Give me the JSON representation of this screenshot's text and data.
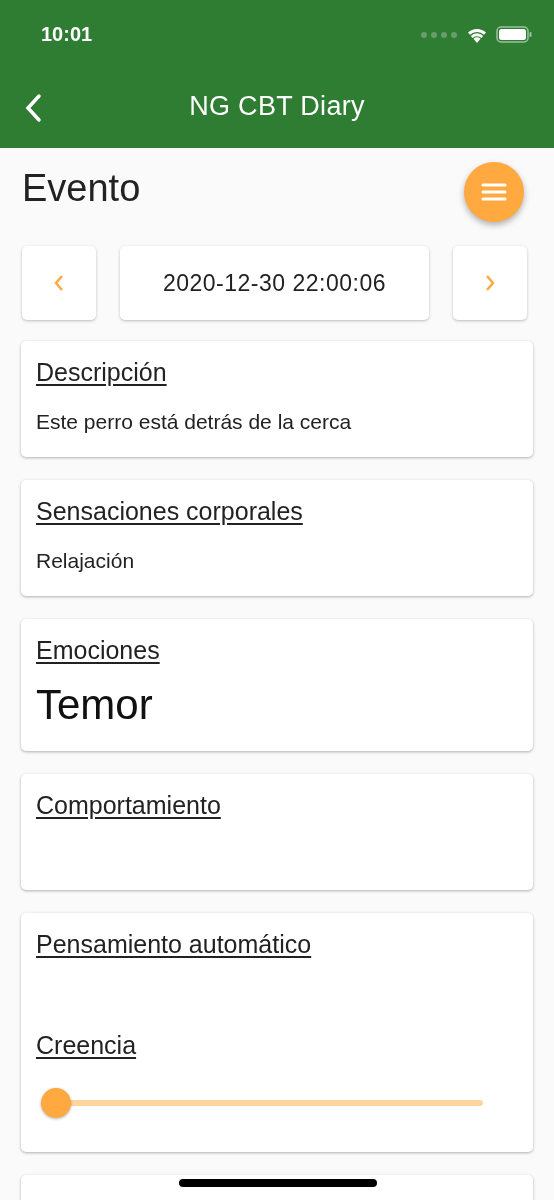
{
  "status_bar": {
    "time": "10:01"
  },
  "nav_bar": {
    "title": "NG CBT Diary"
  },
  "screen_title": "Evento",
  "date_nav": {
    "value": "2020-12-30 22:00:06"
  },
  "cards": [
    {
      "kind": "text",
      "heading": "Descripción",
      "value": "Este perro está detrás de la cerca"
    },
    {
      "kind": "text",
      "heading": "Sensaciones corporales",
      "value": "Relajación"
    },
    {
      "kind": "emphasis",
      "heading": "Emociones",
      "value": "Temor"
    },
    {
      "kind": "empty",
      "heading": "Comportamiento"
    },
    {
      "kind": "thought",
      "heading": "Pensamiento automático",
      "belief": {
        "label": "Creencia",
        "level": 0
      }
    }
  ]
}
